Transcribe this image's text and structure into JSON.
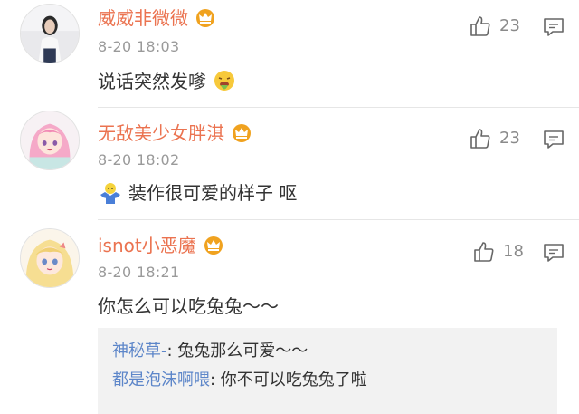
{
  "comments": [
    {
      "username": "威威非微微",
      "time": "8-20 18:03",
      "text": "说话突然发嗲",
      "likes": "23",
      "emoji_icon": "vomit-face-icon",
      "avatar": "profile-photo-girl"
    },
    {
      "username": "无敌美少女胖淇",
      "time": "8-20 18:02",
      "text": "装作很可爱的样子  呕",
      "likes": "23",
      "emoji_icon": "shrug-kid-icon",
      "avatar": "anime-pink-hair-girl"
    },
    {
      "username": "isnot小恶魔",
      "time": "8-20 18:21",
      "text": "你怎么可以吃兔兔～～",
      "likes": "18",
      "avatar": "anime-blonde-girl"
    }
  ],
  "replies": [
    {
      "user": "神秘草-",
      "text": ": 兔兔那么可爱～～"
    },
    {
      "user": "都是泡沫啊喂",
      "text": ": 你不可以吃兔兔了啦"
    }
  ],
  "colors": {
    "username": "#eb7350",
    "reply_user": "#5d86c9",
    "muted": "#9a9a9a",
    "crown": "#f0a21f"
  },
  "icons": {
    "crown": "vip-crown-icon",
    "like": "thumbs-up-icon",
    "reply": "comment-bubble-icon"
  }
}
